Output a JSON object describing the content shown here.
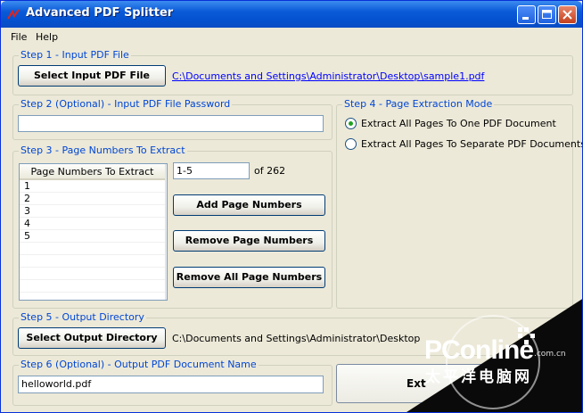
{
  "window": {
    "title": "Advanced PDF Splitter"
  },
  "menu": {
    "file": "File",
    "help": "Help"
  },
  "step1": {
    "legend": "Step 1 - Input PDF File",
    "select_button": "Select Input PDF File",
    "file_path": "C:\\Documents and Settings\\Administrator\\Desktop\\sample1.pdf"
  },
  "step2": {
    "legend": "Step 2 (Optional) - Input PDF File Password",
    "password_value": ""
  },
  "step3": {
    "legend": "Step 3 - Page Numbers To Extract",
    "list_header": "Page Numbers To Extract",
    "list_items": [
      "1",
      "2",
      "3",
      "4",
      "5"
    ],
    "range_value": "1-5",
    "page_count_label": "of 262",
    "add_button": "Add Page Numbers",
    "remove_button": "Remove Page Numbers",
    "remove_all_button": "Remove All Page Numbers"
  },
  "step4": {
    "legend": "Step 4 - Page Extraction Mode",
    "option_one": "Extract All Pages To One PDF Document",
    "option_separate": "Extract All Pages To Separate PDF Documents",
    "selected": "option_one"
  },
  "step5": {
    "legend": "Step 5 - Output Directory",
    "select_button": "Select Output Directory",
    "directory_path": "C:\\Documents and Settings\\Administrator\\Desktop"
  },
  "step6": {
    "legend": "Step 6 (Optional) - Output PDF Document Name",
    "name_value": "helloworld.pdf"
  },
  "extract_button": "Ext",
  "watermark": {
    "brand": "PConline",
    "domain": ".com.cn",
    "chinese": "太平洋电脑网"
  },
  "colors": {
    "accent": "#0046d5",
    "titlebar": "#0a5ad8",
    "link": "#0000ff"
  }
}
